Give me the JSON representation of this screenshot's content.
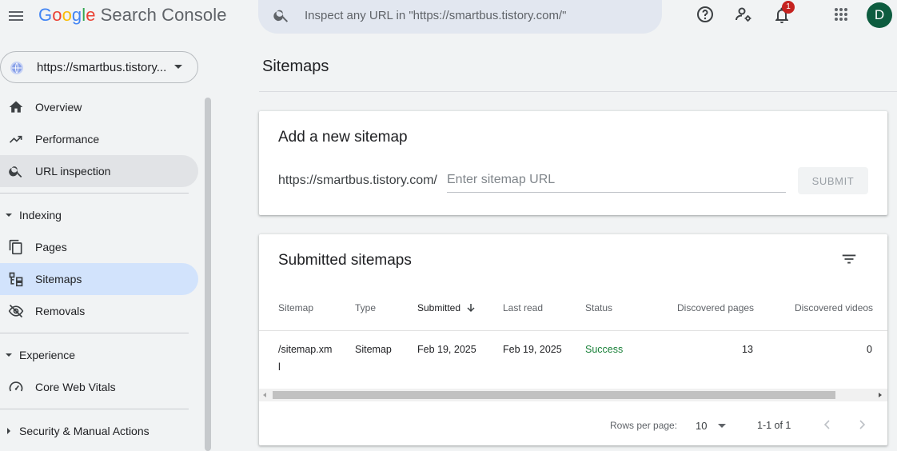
{
  "header": {
    "logo": {
      "g1": "G",
      "o1": "o",
      "o2": "o",
      "g2": "g",
      "l": "l",
      "e": "e",
      "product": "Search Console"
    },
    "search_placeholder": "Inspect any URL in \"https://smartbus.tistory.com/\"",
    "notification_count": "1",
    "avatar_initial": "D"
  },
  "sidebar": {
    "property": "https://smartbus.tistory...",
    "top_items": [
      {
        "label": "Overview",
        "icon": "home-icon"
      },
      {
        "label": "Performance",
        "icon": "trending-up-icon"
      },
      {
        "label": "URL inspection",
        "icon": "search-icon"
      }
    ],
    "indexing": {
      "label": "Indexing",
      "items": [
        {
          "label": "Pages",
          "icon": "pages-icon"
        },
        {
          "label": "Sitemaps",
          "icon": "sitemap-icon"
        },
        {
          "label": "Removals",
          "icon": "visibility-off-icon"
        }
      ]
    },
    "experience": {
      "label": "Experience",
      "items": [
        {
          "label": "Core Web Vitals",
          "icon": "speed-icon"
        }
      ]
    },
    "security": {
      "label": "Security & Manual Actions"
    }
  },
  "main": {
    "title": "Sitemaps",
    "add_card": {
      "title": "Add a new sitemap",
      "prefix": "https://smartbus.tistory.com/",
      "input_value": "",
      "input_placeholder": "Enter sitemap URL",
      "submit_label": "SUBMIT"
    },
    "submitted_card": {
      "title": "Submitted sitemaps",
      "columns": [
        "Sitemap",
        "Type",
        "Submitted",
        "Last read",
        "Status",
        "Discovered pages",
        "Discovered videos"
      ],
      "sorted_column": "Submitted",
      "rows": [
        {
          "sitemap": "/sitemap.xm",
          "sitemap_wrap": "l",
          "type": "Sitemap",
          "submitted": "Feb 19, 2025",
          "last_read": "Feb 19, 2025",
          "status": "Success",
          "pages": "13",
          "videos": "0"
        }
      ],
      "pagination": {
        "rows_per_page_label": "Rows per page:",
        "rows_per_page": "10",
        "range": "1-1 of 1"
      }
    }
  },
  "colors": {
    "active_nav": "#d2e3fc",
    "success": "#188038",
    "badge": "#c5221f",
    "avatar": "#0d5c3f"
  }
}
